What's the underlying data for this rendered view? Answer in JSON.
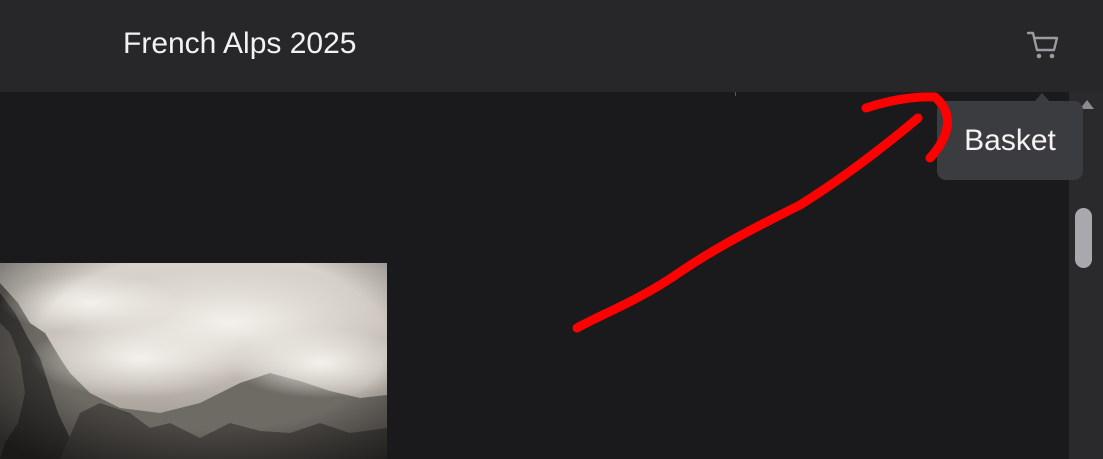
{
  "header": {
    "title": "French Alps 2025",
    "cart_icon": "shopping-cart-icon"
  },
  "tooltip": {
    "label": "Basket"
  },
  "photo": {
    "subject": "mountain-cliffs-in-clouds"
  },
  "colors": {
    "header_bg": "#27272a",
    "content_bg": "#1a1a1c",
    "tooltip_bg": "#3b3c40",
    "annotation": "#ff0000"
  }
}
